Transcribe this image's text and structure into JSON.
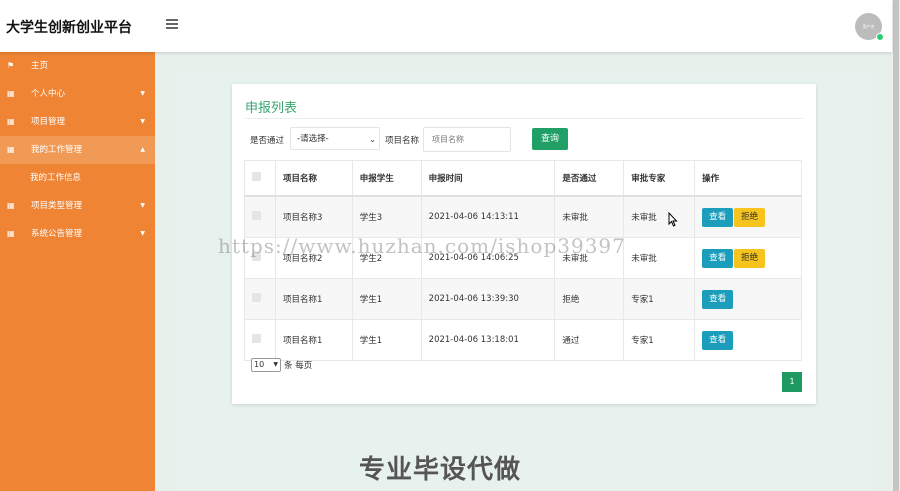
{
  "app": {
    "title": "大学生创新创业平台",
    "avatar_text": "用户名"
  },
  "sidebar": {
    "items": [
      {
        "label": "主页",
        "icon": "flag-icon",
        "has_caret": false
      },
      {
        "label": "个人中心",
        "icon": "grid-icon",
        "has_caret": true
      },
      {
        "label": "项目管理",
        "icon": "grid-icon",
        "has_caret": true
      },
      {
        "label": "我的工作管理",
        "icon": "grid-icon",
        "has_caret": true,
        "active": true
      },
      {
        "label": "项目类型管理",
        "icon": "grid-icon",
        "has_caret": true
      },
      {
        "label": "系统公告管理",
        "icon": "grid-icon",
        "has_caret": true
      }
    ],
    "sub_item": "我的工作信息"
  },
  "main": {
    "title": "申报列表",
    "filter": {
      "passed_label": "是否通过",
      "passed_value": "-请选择-",
      "project_label": "项目名称",
      "project_placeholder": "项目名称",
      "query_label": "查询"
    },
    "table": {
      "headers": [
        "项目名称",
        "申报学生",
        "申报时间",
        "是否通过",
        "审批专家",
        "操作"
      ],
      "rows": [
        {
          "project": "项目名称3",
          "student": "学生3",
          "time": "2021-04-06 14:13:11",
          "passed": "未审批",
          "expert": "未审批",
          "actions": [
            "查看",
            "拒绝"
          ]
        },
        {
          "project": "项目名称2",
          "student": "学生2",
          "time": "2021-04-06 14:06:25",
          "passed": "未审批",
          "expert": "未审批",
          "actions": [
            "查看",
            "拒绝"
          ]
        },
        {
          "project": "项目名称1",
          "student": "学生1",
          "time": "2021-04-06 13:39:30",
          "passed": "拒绝",
          "expert": "专家1",
          "actions": [
            "查看"
          ]
        },
        {
          "project": "项目名称1",
          "student": "学生1",
          "time": "2021-04-06 13:18:01",
          "passed": "通过",
          "expert": "专家1",
          "actions": [
            "查看"
          ]
        }
      ]
    },
    "pagination": {
      "page_size": "10",
      "per_page_label": "条 每页",
      "current_page": "1"
    }
  },
  "overlay": {
    "watermark": "https://www.huzhan.com/ishop39397",
    "promo": "专业毕设代做"
  },
  "colors": {
    "sidebar": "#ee8434",
    "accent_green": "#20a067",
    "view_button": "#1b9dbb",
    "reject_button": "#f6c41c"
  }
}
